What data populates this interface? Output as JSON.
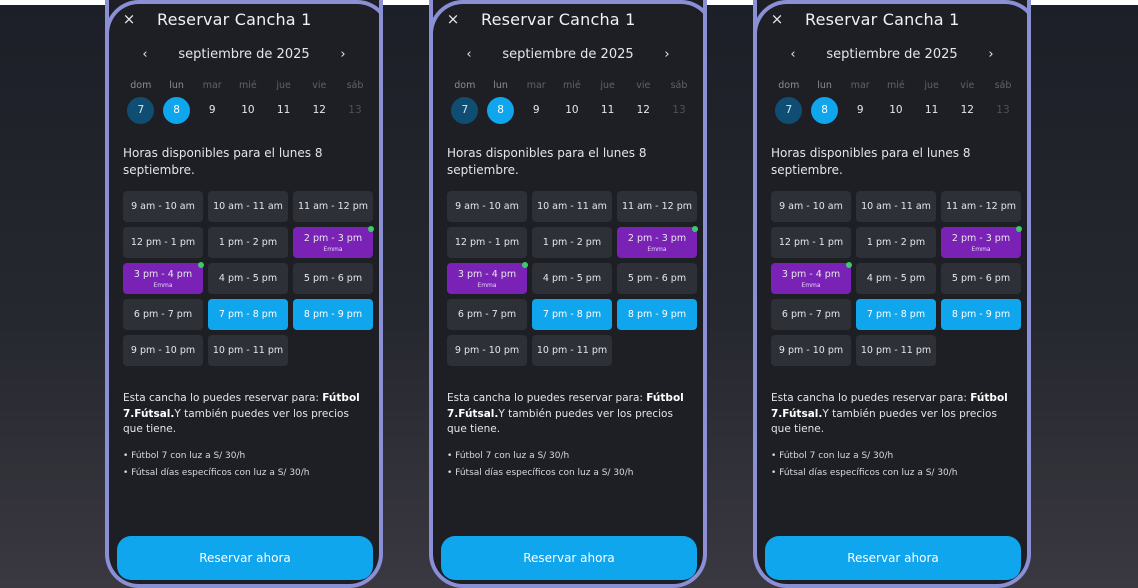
{
  "screen": {
    "title": "Reservar Cancha 1",
    "close_icon": "×",
    "month_label": "septiembre de 2025",
    "prev_icon": "‹",
    "next_icon": "›",
    "weekdays": [
      "dom",
      "lun",
      "mar",
      "mié",
      "jue",
      "vie",
      "sáb"
    ],
    "dates": [
      {
        "day": "7",
        "state": "today"
      },
      {
        "day": "8",
        "state": "selected"
      },
      {
        "day": "9",
        "state": "normal"
      },
      {
        "day": "10",
        "state": "normal"
      },
      {
        "day": "11",
        "state": "normal"
      },
      {
        "day": "12",
        "state": "normal"
      },
      {
        "day": "13",
        "state": "disabled"
      }
    ],
    "available_heading": "Horas disponibles para el lunes 8 septiembre.",
    "slots": [
      {
        "label": "9 am - 10 am",
        "state": "free"
      },
      {
        "label": "10 am - 11 am",
        "state": "free"
      },
      {
        "label": "11 am - 12 pm",
        "state": "free"
      },
      {
        "label": "12 pm - 1 pm",
        "state": "free"
      },
      {
        "label": "1 pm - 2 pm",
        "state": "free"
      },
      {
        "label": "2 pm - 3 pm",
        "state": "booked",
        "who": "Emma"
      },
      {
        "label": "3 pm - 4 pm",
        "state": "booked",
        "who": "Emma"
      },
      {
        "label": "4 pm - 5 pm",
        "state": "free"
      },
      {
        "label": "5 pm - 6 pm",
        "state": "free"
      },
      {
        "label": "6 pm - 7 pm",
        "state": "free"
      },
      {
        "label": "7 pm - 8 pm",
        "state": "selected"
      },
      {
        "label": "8 pm - 9 pm",
        "state": "selected"
      },
      {
        "label": "9 pm - 10 pm",
        "state": "free"
      },
      {
        "label": "10 pm - 11 pm",
        "state": "free"
      }
    ],
    "info_prefix": "Esta cancha lo puedes reservar para: ",
    "info_sports": "Fútbol 7.Fútsal.",
    "info_suffix": "Y también puedes ver los precios que tiene.",
    "prices": [
      "• Fútbol 7 con luz a S/ 30/h",
      "• Fútsal días específicos con luz a S/ 30/h"
    ],
    "cta_label": "Reservar ahora"
  },
  "colors": {
    "accent": "#0fa6ee",
    "booked": "#7a22b6",
    "today": "#0f4e72",
    "frame": "#8a8fd6",
    "status_dot": "#3ccb6b"
  }
}
